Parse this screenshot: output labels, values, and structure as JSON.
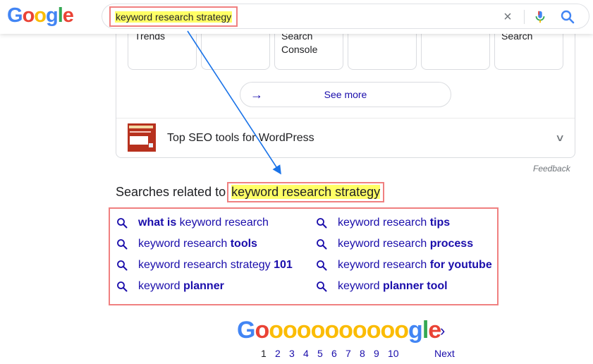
{
  "header": {
    "logo_letters": [
      {
        "ch": "G",
        "color": "#4285F4"
      },
      {
        "ch": "o",
        "color": "#EA4335"
      },
      {
        "ch": "o",
        "color": "#FBBC05"
      },
      {
        "ch": "g",
        "color": "#4285F4"
      },
      {
        "ch": "l",
        "color": "#34A853"
      },
      {
        "ch": "e",
        "color": "#EA4335"
      }
    ],
    "query": "keyword research strategy",
    "clear_icon": "×",
    "mic_icon": "mic-icon",
    "search_icon": "search-icon"
  },
  "tools_panel": {
    "tiles": [
      {
        "line1": "Trends"
      },
      {
        "line1": ""
      },
      {
        "line1": "Search",
        "line2": "Console"
      },
      {
        "line1": ""
      },
      {
        "line1": ""
      },
      {
        "line1": "Search"
      }
    ],
    "see_more": "See more",
    "item_title": "Top SEO tools for WordPress",
    "feedback": "Feedback"
  },
  "related": {
    "heading_prefix": "Searches related to",
    "heading_query": "keyword research strategy",
    "left": [
      {
        "pre": "",
        "bold_pre": "what is",
        "mid": " keyword research",
        "bold_post": ""
      },
      {
        "pre": "",
        "bold_pre": "",
        "mid": "keyword research ",
        "bold_post": "tools"
      },
      {
        "pre": "",
        "bold_pre": "",
        "mid": "keyword research strategy ",
        "bold_post": "101"
      },
      {
        "pre": "",
        "bold_pre": "",
        "mid": "keyword ",
        "bold_post": "planner"
      }
    ],
    "right": [
      {
        "pre": "",
        "bold_pre": "",
        "mid": "keyword research ",
        "bold_post": "tips"
      },
      {
        "pre": "",
        "bold_pre": "",
        "mid": "keyword research ",
        "bold_post": "process"
      },
      {
        "pre": "",
        "bold_pre": "",
        "mid": "keyword research ",
        "bold_post": "for youtube"
      },
      {
        "pre": "",
        "bold_pre": "",
        "mid": "keyword ",
        "bold_post": "planner tool"
      }
    ]
  },
  "pagination": {
    "pages": [
      "1",
      "2",
      "3",
      "4",
      "5",
      "6",
      "7",
      "8",
      "9",
      "10"
    ],
    "current": "1",
    "next": "Next",
    "next_arrow": "›"
  },
  "colors": {
    "link": "#1a0dab",
    "highlight": "#ffff66",
    "annotation_border": "#f08080",
    "annotation_arrow": "#1a73e8"
  }
}
